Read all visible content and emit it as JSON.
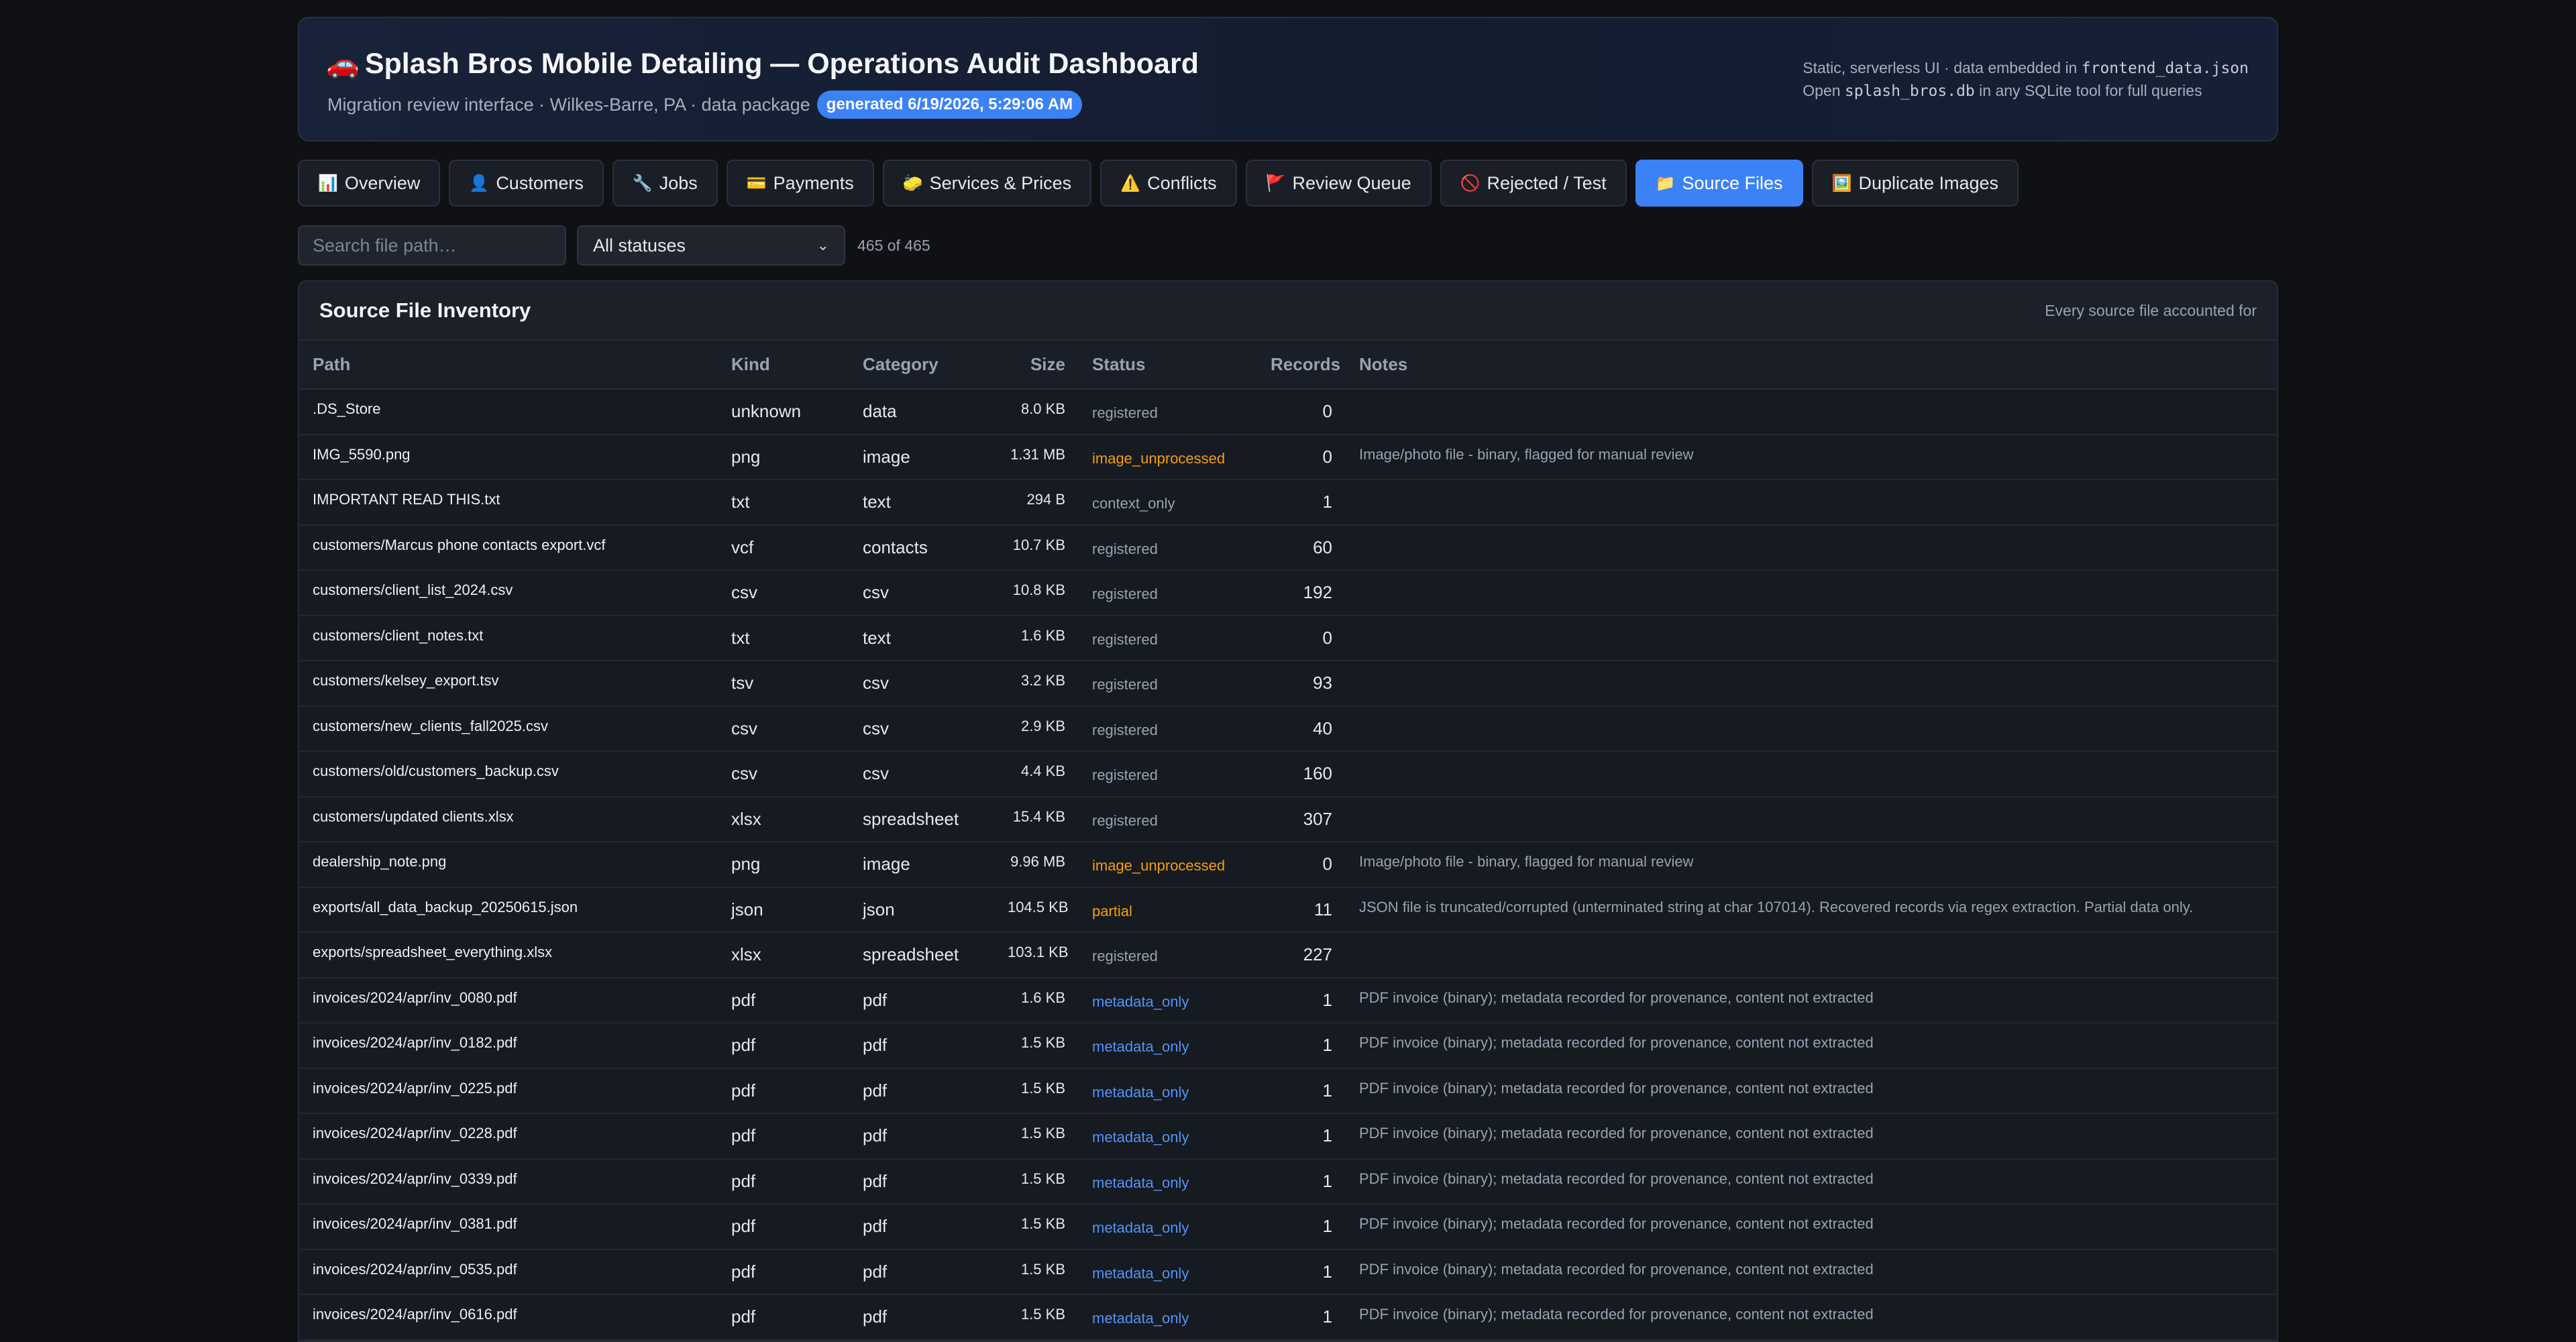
{
  "header": {
    "car_emoji": "🚗",
    "title": "Splash Bros Mobile Detailing — Operations Audit Dashboard",
    "subtitle": "Migration review interface · Wilkes-Barre, PA · data package",
    "badge": "generated 6/19/2026, 5:29:06 AM",
    "meta_line1_prefix": "Static, serverless UI · data embedded in ",
    "meta_line1_code": "frontend_data.json",
    "meta_line2_prefix": "Open ",
    "meta_line2_code": "splash_bros.db",
    "meta_line2_suffix": " in any SQLite tool for full queries"
  },
  "tabs": [
    {
      "icon": "📊",
      "label": "Overview"
    },
    {
      "icon": "👤",
      "label": "Customers"
    },
    {
      "icon": "🔧",
      "label": "Jobs"
    },
    {
      "icon": "💳",
      "label": "Payments"
    },
    {
      "icon": "🧽",
      "label": "Services & Prices"
    },
    {
      "icon": "⚠️",
      "label": "Conflicts"
    },
    {
      "icon": "🚩",
      "label": "Review Queue"
    },
    {
      "icon": "🚫",
      "label": "Rejected / Test"
    },
    {
      "icon": "📁",
      "label": "Source Files",
      "active": true
    },
    {
      "icon": "🖼️",
      "label": "Duplicate Images"
    }
  ],
  "filters": {
    "search_placeholder": "Search file path…",
    "status_selected": "All statuses",
    "count": "465 of 465"
  },
  "panel": {
    "title": "Source File Inventory",
    "subtitle": "Every source file accounted for"
  },
  "table": {
    "columns": [
      "Path",
      "Kind",
      "Category",
      "Size",
      "Status",
      "Records",
      "Notes"
    ],
    "rows": [
      {
        "path": ".DS_Store",
        "kind": "unknown",
        "category": "data",
        "size": "8.0 KB",
        "status": "registered",
        "records": "0",
        "notes": ""
      },
      {
        "path": "IMG_5590.png",
        "kind": "png",
        "category": "image",
        "size": "1.31 MB",
        "status": "image_unprocessed",
        "records": "0",
        "notes": "Image/photo file - binary, flagged for manual review"
      },
      {
        "path": "IMPORTANT READ THIS.txt",
        "kind": "txt",
        "category": "text",
        "size": "294 B",
        "status": "context_only",
        "records": "1",
        "notes": ""
      },
      {
        "path": "customers/Marcus phone contacts export.vcf",
        "kind": "vcf",
        "category": "contacts",
        "size": "10.7 KB",
        "status": "registered",
        "records": "60",
        "notes": ""
      },
      {
        "path": "customers/client_list_2024.csv",
        "kind": "csv",
        "category": "csv",
        "size": "10.8 KB",
        "status": "registered",
        "records": "192",
        "notes": ""
      },
      {
        "path": "customers/client_notes.txt",
        "kind": "txt",
        "category": "text",
        "size": "1.6 KB",
        "status": "registered",
        "records": "0",
        "notes": ""
      },
      {
        "path": "customers/kelsey_export.tsv",
        "kind": "tsv",
        "category": "csv",
        "size": "3.2 KB",
        "status": "registered",
        "records": "93",
        "notes": ""
      },
      {
        "path": "customers/new_clients_fall2025.csv",
        "kind": "csv",
        "category": "csv",
        "size": "2.9 KB",
        "status": "registered",
        "records": "40",
        "notes": ""
      },
      {
        "path": "customers/old/customers_backup.csv",
        "kind": "csv",
        "category": "csv",
        "size": "4.4 KB",
        "status": "registered",
        "records": "160",
        "notes": ""
      },
      {
        "path": "customers/updated clients.xlsx",
        "kind": "xlsx",
        "category": "spreadsheet",
        "size": "15.4 KB",
        "status": "registered",
        "records": "307",
        "notes": ""
      },
      {
        "path": "dealership_note.png",
        "kind": "png",
        "category": "image",
        "size": "9.96 MB",
        "status": "image_unprocessed",
        "records": "0",
        "notes": "Image/photo file - binary, flagged for manual review"
      },
      {
        "path": "exports/all_data_backup_20250615.json",
        "kind": "json",
        "category": "json",
        "size": "104.5 KB",
        "status": "partial",
        "records": "11",
        "notes": "JSON file is truncated/corrupted (unterminated string at char 107014). Recovered records via regex extraction. Partial data only."
      },
      {
        "path": "exports/spreadsheet_everything.xlsx",
        "kind": "xlsx",
        "category": "spreadsheet",
        "size": "103.1 KB",
        "status": "registered",
        "records": "227",
        "notes": ""
      },
      {
        "path": "invoices/2024/apr/inv_0080.pdf",
        "kind": "pdf",
        "category": "pdf",
        "size": "1.6 KB",
        "status": "metadata_only",
        "records": "1",
        "notes": "PDF invoice (binary); metadata recorded for provenance, content not extracted"
      },
      {
        "path": "invoices/2024/apr/inv_0182.pdf",
        "kind": "pdf",
        "category": "pdf",
        "size": "1.5 KB",
        "status": "metadata_only",
        "records": "1",
        "notes": "PDF invoice (binary); metadata recorded for provenance, content not extracted"
      },
      {
        "path": "invoices/2024/apr/inv_0225.pdf",
        "kind": "pdf",
        "category": "pdf",
        "size": "1.5 KB",
        "status": "metadata_only",
        "records": "1",
        "notes": "PDF invoice (binary); metadata recorded for provenance, content not extracted"
      },
      {
        "path": "invoices/2024/apr/inv_0228.pdf",
        "kind": "pdf",
        "category": "pdf",
        "size": "1.5 KB",
        "status": "metadata_only",
        "records": "1",
        "notes": "PDF invoice (binary); metadata recorded for provenance, content not extracted"
      },
      {
        "path": "invoices/2024/apr/inv_0339.pdf",
        "kind": "pdf",
        "category": "pdf",
        "size": "1.5 KB",
        "status": "metadata_only",
        "records": "1",
        "notes": "PDF invoice (binary); metadata recorded for provenance, content not extracted"
      },
      {
        "path": "invoices/2024/apr/inv_0381.pdf",
        "kind": "pdf",
        "category": "pdf",
        "size": "1.5 KB",
        "status": "metadata_only",
        "records": "1",
        "notes": "PDF invoice (binary); metadata recorded for provenance, content not extracted"
      },
      {
        "path": "invoices/2024/apr/inv_0535.pdf",
        "kind": "pdf",
        "category": "pdf",
        "size": "1.5 KB",
        "status": "metadata_only",
        "records": "1",
        "notes": "PDF invoice (binary); metadata recorded for provenance, content not extracted"
      },
      {
        "path": "invoices/2024/apr/inv_0616.pdf",
        "kind": "pdf",
        "category": "pdf",
        "size": "1.5 KB",
        "status": "metadata_only",
        "records": "1",
        "notes": "PDF invoice (binary); metadata recorded for provenance, content not extracted"
      }
    ]
  },
  "colors": {
    "background": "#0f1115",
    "accent": "#3b82f6",
    "status_warning": "#f59e0b",
    "status_metadata": "#4f95f5",
    "muted": "#9aa2b2"
  }
}
